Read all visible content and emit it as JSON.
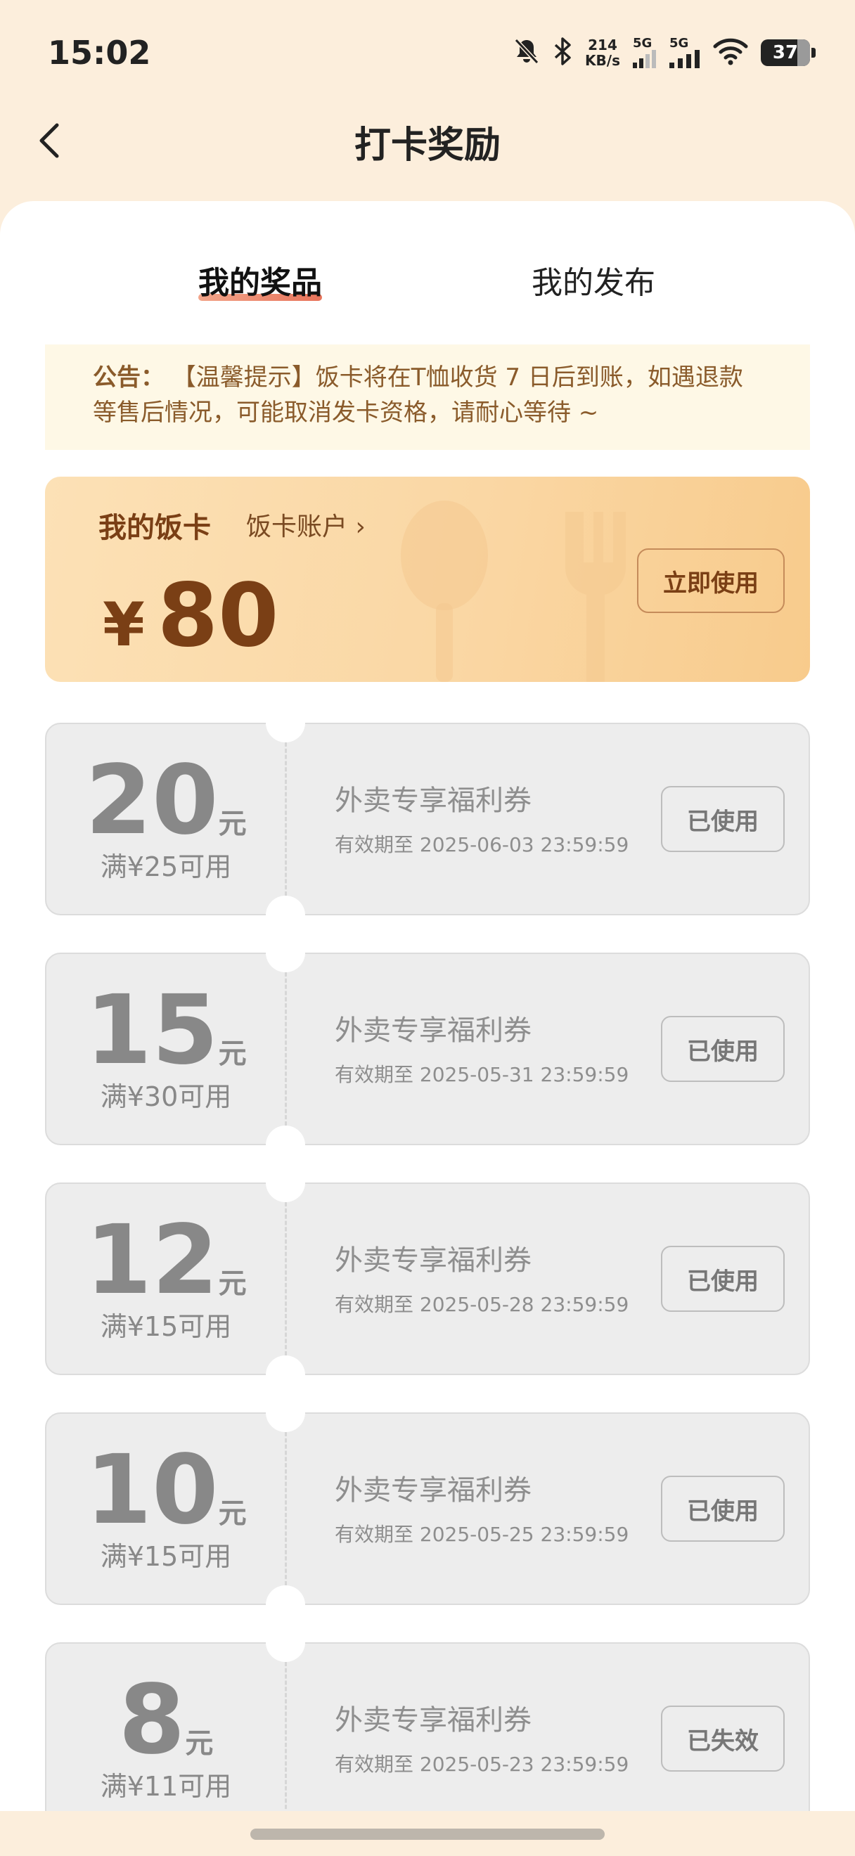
{
  "status_bar": {
    "time": "15:02",
    "net_speed_value": "214",
    "net_speed_unit": "KB/s",
    "sim1_label": "5G",
    "sim2_label": "5G",
    "battery_level": "37"
  },
  "nav": {
    "title": "打卡奖励"
  },
  "tabs": [
    {
      "label": "我的奖品",
      "active": true
    },
    {
      "label": "我的发布",
      "active": false
    }
  ],
  "notice": {
    "prefix": "公告：",
    "text": "【温馨提示】饭卡将在T恤收货 7 日后到账，如遇退款等售后情况，可能取消发卡资格，请耐心等待 ~"
  },
  "fanka": {
    "title": "我的饭卡",
    "account_link": "饭卡账户 ›",
    "currency": "¥",
    "amount": "80",
    "use_button": "立即使用"
  },
  "coupons": [
    {
      "amount": "20",
      "unit": "元",
      "condition": "满¥25可用",
      "title": "外卖专享福利券",
      "expiry": "有效期至 2025-06-03 23:59:59",
      "status": "已使用"
    },
    {
      "amount": "15",
      "unit": "元",
      "condition": "满¥30可用",
      "title": "外卖专享福利券",
      "expiry": "有效期至 2025-05-31 23:59:59",
      "status": "已使用"
    },
    {
      "amount": "12",
      "unit": "元",
      "condition": "满¥15可用",
      "title": "外卖专享福利券",
      "expiry": "有效期至 2025-05-28 23:59:59",
      "status": "已使用"
    },
    {
      "amount": "10",
      "unit": "元",
      "condition": "满¥15可用",
      "title": "外卖专享福利券",
      "expiry": "有效期至 2025-05-25 23:59:59",
      "status": "已使用"
    },
    {
      "amount": "8",
      "unit": "元",
      "condition": "满¥11可用",
      "title": "外卖专享福利券",
      "expiry": "有效期至 2025-05-23 23:59:59",
      "status": "已失效"
    }
  ],
  "colors": {
    "page_bg": "#FCEEDC",
    "accent_brown": "#7A3F15",
    "tab_underline": "#E8735A",
    "coupon_bg": "#EDEDED"
  },
  "icons": {
    "back": "chevron-left-icon",
    "mute": "bell-off-icon",
    "bluetooth": "bluetooth-icon",
    "wifi": "wifi-icon",
    "deco": "spoon-fork-icon"
  }
}
